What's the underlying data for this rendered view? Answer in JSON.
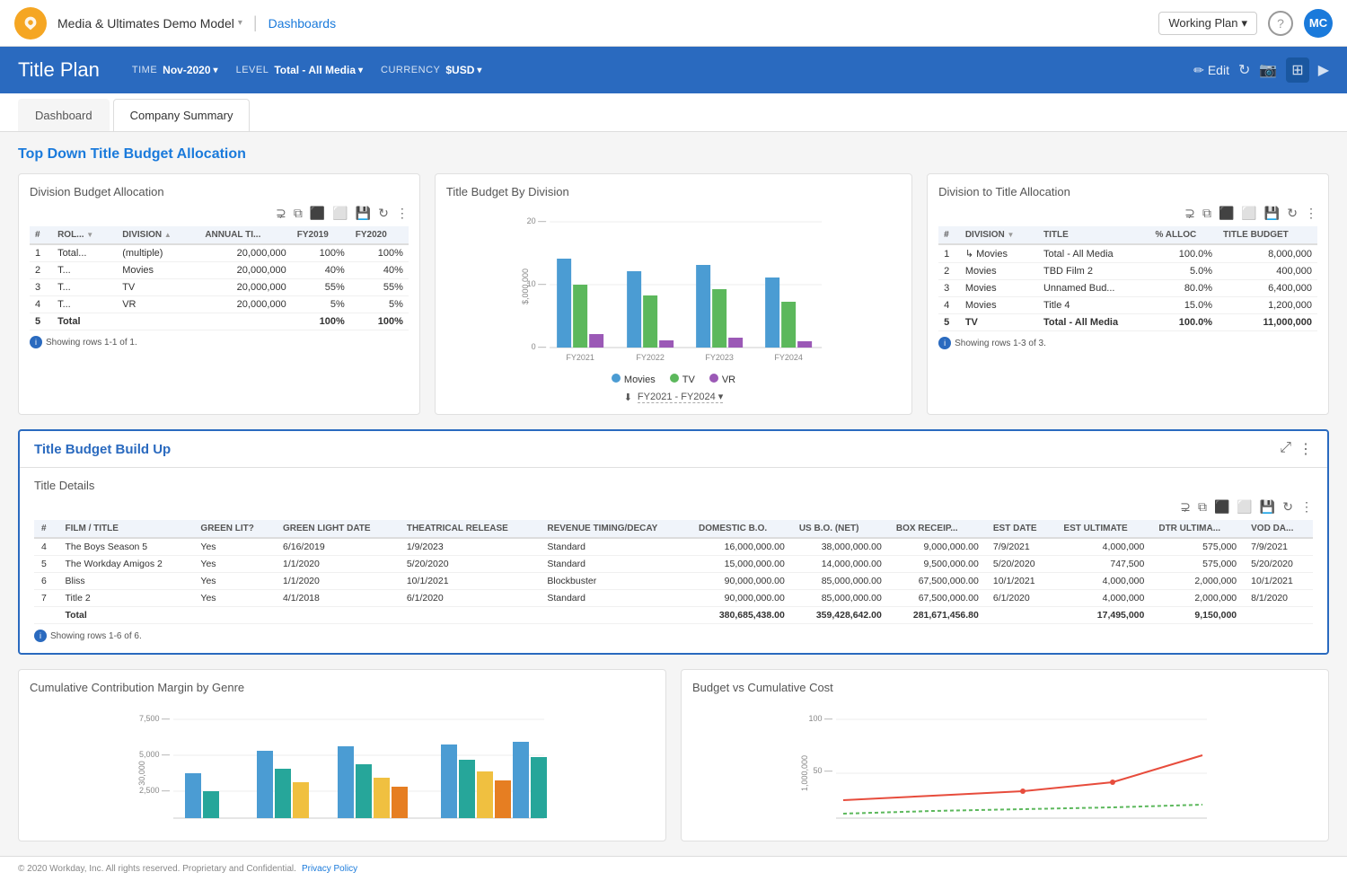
{
  "topNav": {
    "appName": "Media & Ultimates Demo Model",
    "appArrow": "▾",
    "navLink": "Dashboards",
    "workingPlan": "Working Plan",
    "helpIcon": "?",
    "avatarInitials": "MC"
  },
  "titleBar": {
    "title": "Title Plan",
    "timeLabel": "TIME",
    "timeValue": "Nov-2020",
    "levelLabel": "LEVEL",
    "levelValue": "Total - All Media",
    "currencyLabel": "CURRENCY",
    "currencyValue": "$USD",
    "editLabel": "Edit"
  },
  "tabs": {
    "items": [
      {
        "label": "Dashboard",
        "active": false
      },
      {
        "label": "Company Summary",
        "active": true
      }
    ]
  },
  "topSection": {
    "title": "Top Down Title Budget Allocation"
  },
  "divisionBudget": {
    "title": "Division Budget Allocation",
    "columns": [
      "#",
      "ROL...",
      "DIVISION",
      "ANNUAL TI...",
      "FY2019",
      "FY2020"
    ],
    "rows": [
      [
        "1",
        "Total...",
        "(multiple)",
        "20,000,000",
        "100%",
        "100%"
      ],
      [
        "2",
        "T...",
        "Movies",
        "20,000,000",
        "40%",
        "40%"
      ],
      [
        "3",
        "T...",
        "TV",
        "20,000,000",
        "55%",
        "55%"
      ],
      [
        "4",
        "T...",
        "VR",
        "20,000,000",
        "5%",
        "5%"
      ],
      [
        "5",
        "Total",
        "",
        "",
        "100%",
        "100%"
      ]
    ],
    "showingInfo": "Showing rows 1-1 of 1."
  },
  "titleBudgetByDivision": {
    "title": "Title Budget By Division",
    "yAxisMax": 20,
    "yAxisMid": 10,
    "yAxisLabel": "$,000,000",
    "xLabels": [
      "FY2021",
      "FY2022",
      "FY2023",
      "FY2024"
    ],
    "legend": [
      {
        "label": "Movies",
        "color": "#4b9cd3"
      },
      {
        "label": "TV",
        "color": "#5cb85c"
      },
      {
        "label": "VR",
        "color": "#9b59b6"
      }
    ],
    "filterLabel": "FY2021 - FY2024",
    "bars": {
      "FY2021": [
        14,
        10,
        2
      ],
      "FY2022": [
        12,
        8,
        1
      ],
      "FY2023": [
        13,
        9,
        1.5
      ],
      "FY2024": [
        11,
        7,
        1
      ]
    }
  },
  "divisionToTitle": {
    "title": "Division to Title Allocation",
    "columns": [
      "#",
      "DIVISION",
      "TITLE",
      "% ALLOC",
      "TITLE BUDGET",
      ""
    ],
    "rows": [
      [
        "1",
        "Movies",
        "Total - All Media",
        "100.0%",
        "8,000,000",
        ""
      ],
      [
        "2",
        "Movies",
        "TBD Film 2",
        "5.0%",
        "400,000",
        ""
      ],
      [
        "3",
        "Movies",
        "Unnamed Bud...",
        "80.0%",
        "6,400,000",
        ""
      ],
      [
        "4",
        "Movies",
        "Title 4",
        "15.0%",
        "1,200,000",
        ""
      ],
      [
        "5",
        "TV",
        "Total - All Media",
        "100.0%",
        "11,000,000",
        ""
      ]
    ],
    "showingInfo": "Showing rows 1-3 of 3."
  },
  "titleBudgetBuildUp": {
    "title": "Title Budget Build Up",
    "innerTitle": "Title Details",
    "columns": [
      "#",
      "FILM / TITLE",
      "GREEN LIT?",
      "GREEN LIGHT DATE",
      "THEATRICAL RELEASE",
      "REVENUE TIMING/DECAY",
      "DOMESTIC B.O.",
      "US B.O. (NET)",
      "BOX RECEIP...",
      "EST DATE",
      "EST ULTIMATE",
      "DTR ULTIMA...",
      "VOD DA..."
    ],
    "rows": [
      [
        "4",
        "The Boys Season 5",
        "Yes",
        "6/16/2019",
        "1/9/2023",
        "Standard",
        "16,000,000.00",
        "38,000,000.00",
        "9,000,000.00",
        "7/9/2021",
        "4,000,000",
        "575,000",
        "7/9/2021"
      ],
      [
        "5",
        "The Workday Amigos 2",
        "Yes",
        "1/1/2020",
        "5/20/2020",
        "Standard",
        "15,000,000.00",
        "14,000,000.00",
        "9,500,000.00",
        "5/20/2020",
        "747,500",
        "575,000",
        "5/20/2020"
      ],
      [
        "6",
        "Bliss",
        "Yes",
        "1/1/2020",
        "10/1/2021",
        "Blockbuster",
        "90,000,000.00",
        "85,000,000.00",
        "67,500,000.00",
        "10/1/2021",
        "4,000,000",
        "2,000,000",
        "10/1/2021"
      ],
      [
        "7",
        "Title 2",
        "Yes",
        "4/1/2018",
        "6/1/2020",
        "Standard",
        "90,000,000.00",
        "85,000,000.00",
        "67,500,000.00",
        "6/1/2020",
        "4,000,000",
        "2,000,000",
        "8/1/2020"
      ],
      [
        "",
        "Total",
        "",
        "",
        "",
        "",
        "380,685,438.00",
        "359,428,642.00",
        "281,671,456.80",
        "",
        "17,495,000",
        "9,150,000",
        ""
      ]
    ],
    "showingInfo": "Showing rows 1-6 of 6."
  },
  "cumulativeMargin": {
    "title": "Cumulative Contribution Margin by Genre",
    "yLabels": [
      "7,500",
      "5,000",
      "2,500"
    ],
    "yAxisLabel": "30,000",
    "xLabels": [
      "",
      "",
      "",
      "",
      ""
    ],
    "barColors": [
      "#4b9cd3",
      "#5cb85c",
      "#f0c040",
      "#e67e22"
    ]
  },
  "budgetVsCost": {
    "title": "Budget vs Cumulative Cost",
    "yLabels": [
      "100",
      "50"
    ],
    "yAxisLabel": "1,000,000"
  },
  "footer": {
    "copyright": "© 2020 Workday, Inc. All rights reserved. Proprietary and Confidential.",
    "policyLabel": "Privacy Policy",
    "policyUrl": "#"
  }
}
